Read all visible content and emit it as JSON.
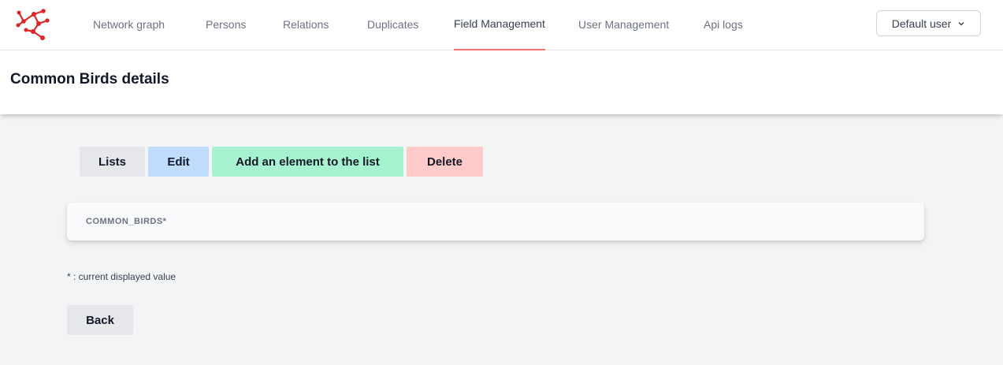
{
  "nav": {
    "logo": "network-logo-icon",
    "items": [
      {
        "label": "Network graph"
      },
      {
        "label": "Persons"
      },
      {
        "label": "Relations"
      },
      {
        "label": "Duplicates"
      },
      {
        "label": "Field Management",
        "active": true
      },
      {
        "label": "User Management"
      },
      {
        "label": "Api logs"
      }
    ],
    "user_menu": {
      "label": "Default user",
      "icon": "chevron-down-icon"
    }
  },
  "header": {
    "title_bold": "Common Birds",
    "title_rest": " details"
  },
  "actions": {
    "lists": "Lists",
    "edit": "Edit",
    "add": "Add an element to the list",
    "delete": "Delete"
  },
  "card": {
    "label": "COMMON_BIRDS*"
  },
  "footnote": "* : current displayed value",
  "back": "Back",
  "colors": {
    "accent": "#f87171",
    "edit": "#bfdbfe",
    "add": "#a7f3d0",
    "delete": "#fecaca",
    "neutral": "#e5e7eb"
  }
}
